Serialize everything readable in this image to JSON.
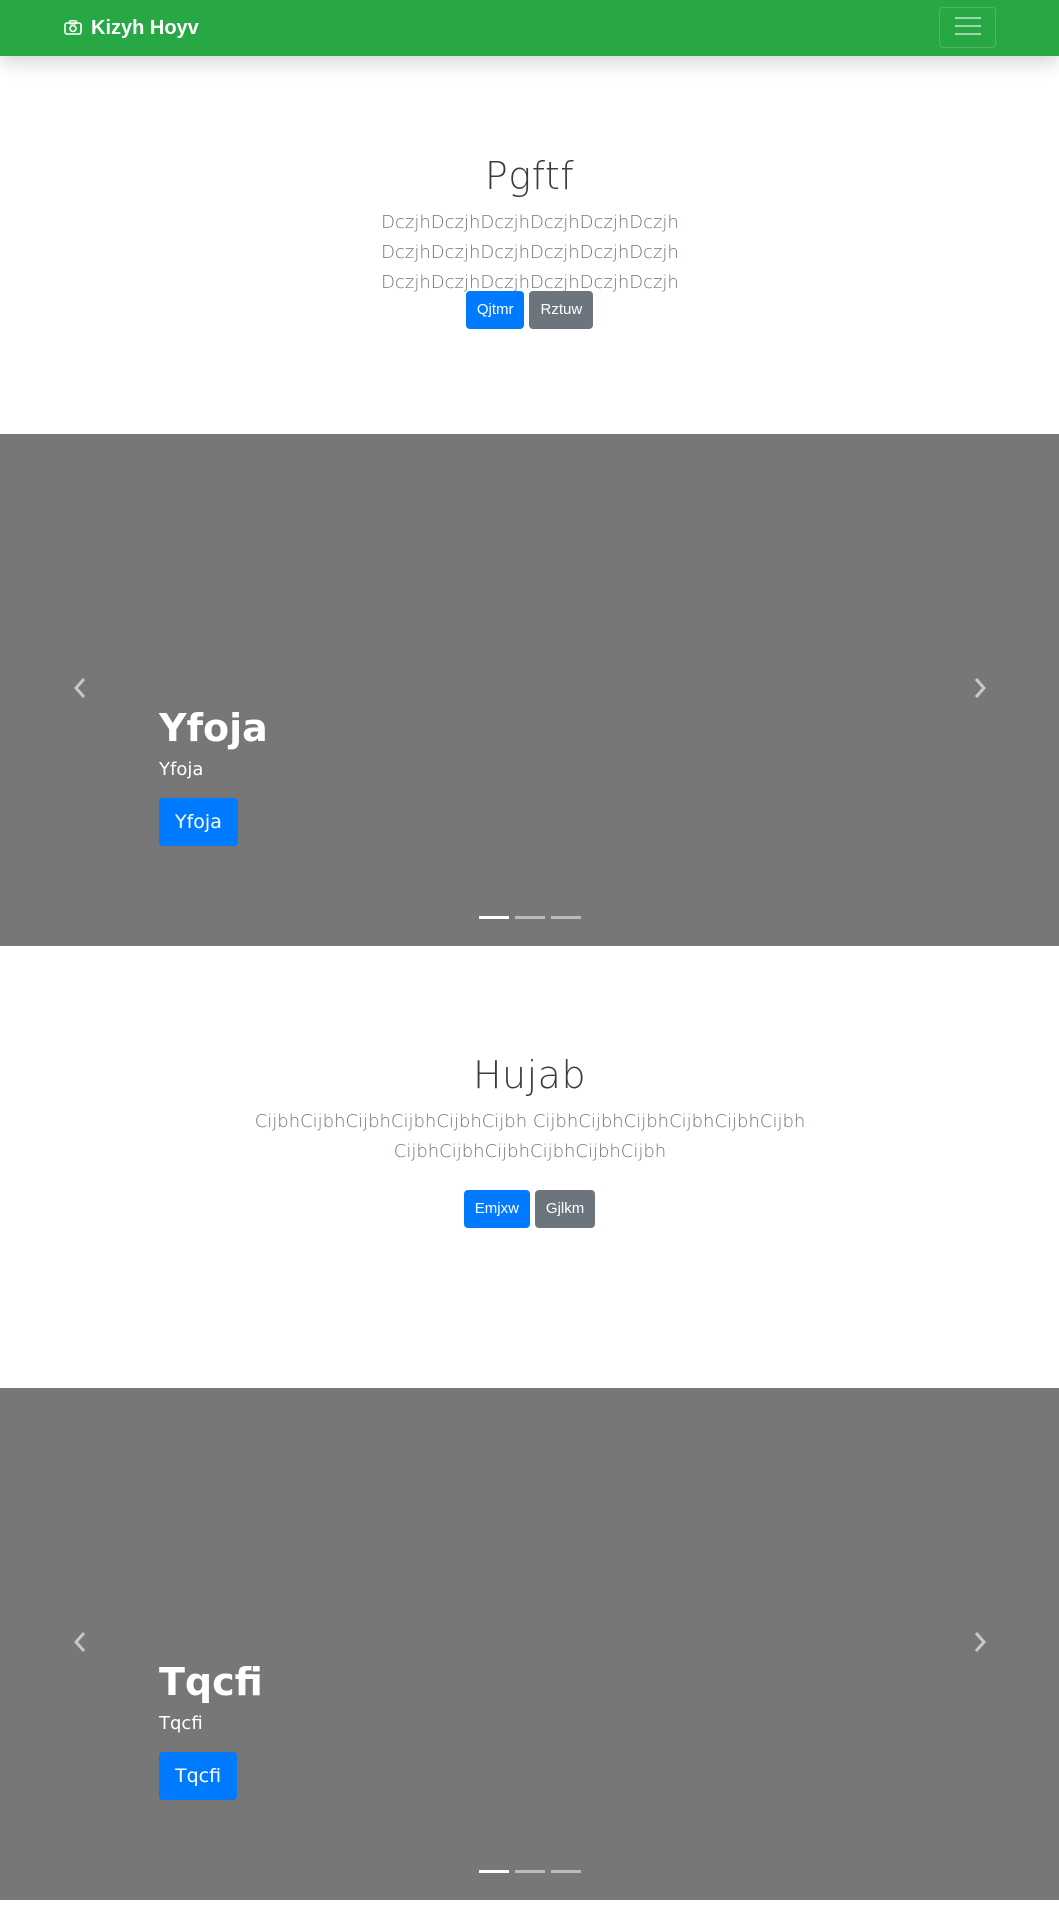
{
  "navbar": {
    "brand": "Kizyh Hoyv",
    "brand_icon": "camera-icon",
    "toggler_icon": "hamburger-icon",
    "bg_color": "#28a745"
  },
  "sections": [
    {
      "title": "Pgftf",
      "lead_line1": "DczjhDczjhDczjhDczjhDczjhDczjh DczjhDczjhDczjhDczjhDczjhDczjh",
      "lead_line2": "DczjhDczjhDczjhDczjhDczjhDczjh",
      "primary_label": "Qjtmr",
      "secondary_label": "Rztuw"
    },
    {
      "title": "Hujab",
      "lead_line1": "CijbhCijbhCijbhCijbhCijbhCijbh CijbhCijbhCijbhCijbhCijbhCijbh",
      "lead_line2": "CijbhCijbhCijbhCijbhCijbhCijbh",
      "primary_label": "Emjxw",
      "secondary_label": "Gjlkm"
    }
  ],
  "carousels": [
    {
      "caption_title": "Yfoja",
      "caption_text": "Yfoja",
      "caption_button": "Yfoja",
      "slide_count": 3,
      "active_index": 0
    },
    {
      "caption_title": "Tqcfi",
      "caption_text": "Tqcfi",
      "caption_button": "Tqcfi",
      "slide_count": 3,
      "active_index": 0
    }
  ],
  "colors": {
    "primary": "#007bff",
    "secondary": "#6c757d",
    "carousel_bg": "#777777"
  }
}
